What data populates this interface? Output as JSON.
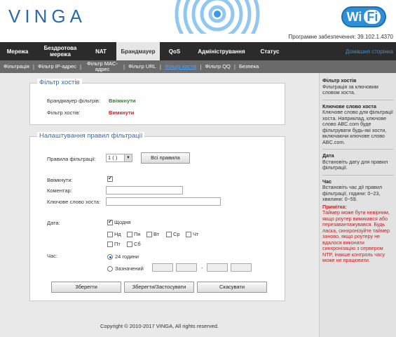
{
  "header": {
    "logo": "VINGA",
    "wifi_left": "Wi",
    "wifi_right": "Fi",
    "firmware": "Програмне забезпечення: 39.102.1.4370"
  },
  "mainnav": {
    "items": [
      "Мережа",
      "Бездротова мережа",
      "NAT",
      "Брандмауер",
      "QoS",
      "Адміністрування",
      "Статус"
    ],
    "home": "Домашня сторінка"
  },
  "subnav": {
    "items": [
      "Фільтрація",
      "Фільтр IP-адрес",
      "Фільтр MAC-адрес",
      "Фільтр URL",
      "Фільтр хостів",
      "Фільтр QQ",
      "Безпека"
    ]
  },
  "panel1": {
    "title": "Фільтр хостів",
    "firewall_label": "Брандмауер фільтрів:",
    "firewall_value": "Ввімкнути",
    "hostfilter_label": "Фільтр хостів:",
    "hostfilter_value": "Вимкнути"
  },
  "panel2": {
    "title": "Налаштування правил фільтрації",
    "rules_label": "Правила фільтрації:",
    "rules_select": "1 ( )",
    "all_rules_button": "Всі правила",
    "enable_label": "Ввімкнути:",
    "enable_checked": "✔",
    "comment_label": "Коментар:",
    "keyword_label": "Ключове слово хоста:",
    "date_label": "Дата:",
    "daily_label": "Щодня",
    "days": [
      "Нд",
      "Пн",
      "Вт",
      "Ср",
      "Чт",
      "Пт",
      "Сб"
    ],
    "time_label": "Час:",
    "time_24h": "24 години",
    "time_custom": "Зазначений",
    "time_sep": "-",
    "save_button": "Зберегти",
    "save_apply_button": "Зберегти/Застосувати",
    "cancel_button": "Скасувати"
  },
  "copyright": "Copyright © 2010-2017 VINGA, All rights reserved.",
  "sidebar": {
    "s1_title": "Фільтр хостів",
    "s1_text": "Фільтрація за ключовим словом хоста.",
    "s2_title": "Ключове слово хоста",
    "s2_text": "Ключове слово для фільтрації хоста. Наприклад, ключове слово ABC.com буде фільтрувати будь-які хости, включаючи ключове слово ABC.com.",
    "s3_title": "Дата",
    "s3_text": "Встановіть дату для правил фільтрації.",
    "s4_title": "Час",
    "s4_text": "Встановіть час дії правил фільтрації, години: 0~23, хвилини: 0~59.",
    "note_title": "Примітка:",
    "note_text": "Таймер може бути невірним, якщо роутер вимикався або перезавантажувався. Будь ласка, синхронізуйте таймер заново, якщо роутеру не вдалося виконати синхронізацію з сервером NTP, інакше контроль часу може не працювати."
  },
  "colors": {
    "accent": "#2e6eb5",
    "nav_bg": "#2b2b2b",
    "subnav_bg": "#6a6a6a",
    "enabled": "#2a8a2a",
    "disabled": "#c81e1e"
  }
}
